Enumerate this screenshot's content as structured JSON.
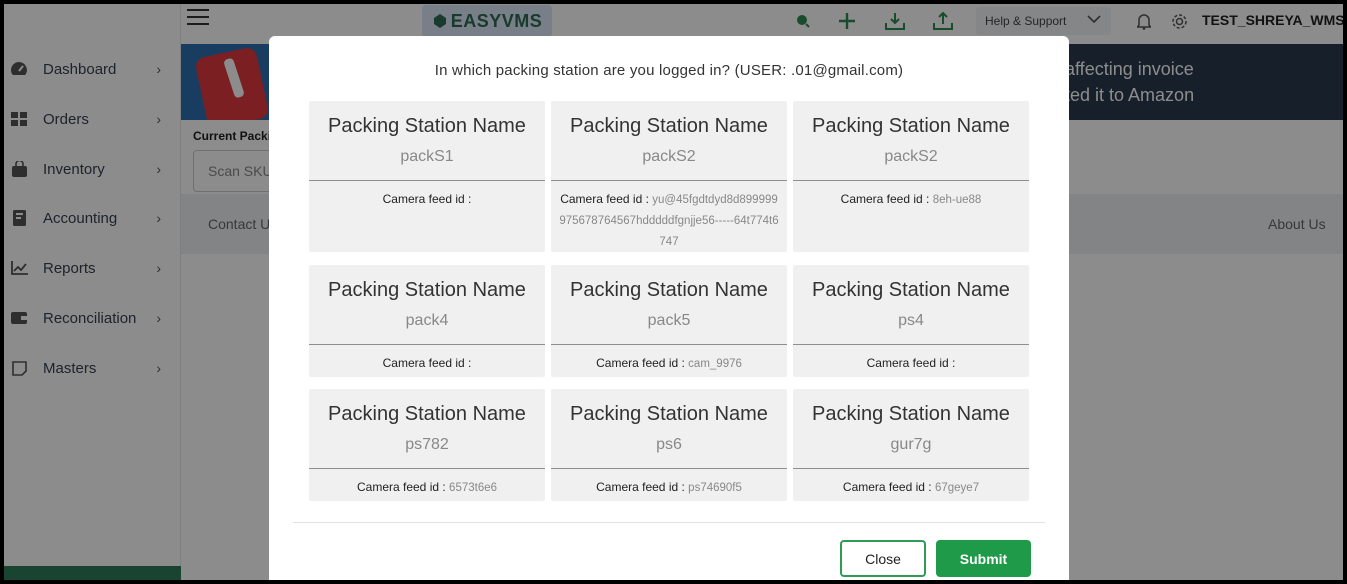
{
  "header": {
    "logo_text": "EASYVMS",
    "help_label": "Help & Support",
    "username": "TEST_SHREYA_WMS"
  },
  "sidebar": {
    "items": [
      {
        "label": "Dashboard",
        "icon": "dashboard-icon"
      },
      {
        "label": "Orders",
        "icon": "grid-icon"
      },
      {
        "label": "Inventory",
        "icon": "bag-icon"
      },
      {
        "label": "Accounting",
        "icon": "book-icon"
      },
      {
        "label": "Reports",
        "icon": "chart-icon"
      },
      {
        "label": "Reconciliation",
        "icon": "wallet-icon"
      },
      {
        "label": "Masters",
        "icon": "note-icon"
      }
    ]
  },
  "page": {
    "banner_line1": "affecting invoice",
    "banner_line2": "ted it to Amazon",
    "current_packing_label": "Current Packi",
    "scan_placeholder": "Scan SKU",
    "contact_link": "Contact U",
    "about_link": "About Us"
  },
  "modal": {
    "title": "In which packing station are you logged in? (USER:              .01@gmail.com)",
    "feed_label": "Camera feed id :",
    "stations": [
      {
        "name": "Packing Station Name",
        "id": "packS1",
        "feed": ""
      },
      {
        "name": "Packing Station Name",
        "id": "packS2",
        "feed": "yu@45fgdtdyd8d899999975678764567hdddddfgnjje56-----64t774t6747"
      },
      {
        "name": "Packing Station Name",
        "id": "packS2",
        "feed": "8eh-ue88"
      },
      {
        "name": "Packing Station Name",
        "id": "pack4",
        "feed": ""
      },
      {
        "name": "Packing Station Name",
        "id": "pack5",
        "feed": "cam_9976"
      },
      {
        "name": "Packing Station Name",
        "id": "ps4",
        "feed": ""
      },
      {
        "name": "Packing Station Name",
        "id": "ps782",
        "feed": "6573t6e6"
      },
      {
        "name": "Packing Station Name",
        "id": "ps6",
        "feed": "ps74690f5"
      },
      {
        "name": "Packing Station Name",
        "id": "gur7g",
        "feed": "67geye7"
      }
    ],
    "close_label": "Close",
    "submit_label": "Submit"
  },
  "colors": {
    "brand_green": "#1e9a49",
    "banner_bg": "#2a3a4d"
  }
}
